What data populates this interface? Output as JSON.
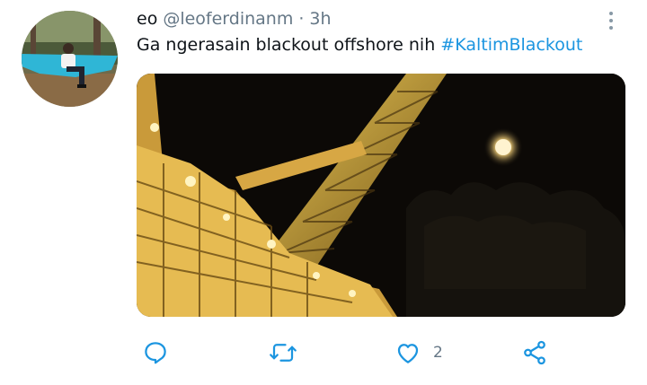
{
  "tweet": {
    "display_name": "eo",
    "handle": "@leoferdinanm",
    "separator": "·",
    "time": "3h",
    "text": "Ga ngerasain blackout  offshore nih",
    "hashtag": "#KaltimBlackout"
  },
  "actions": {
    "reply_count": "",
    "retweet_count": "",
    "like_count": "2",
    "share_count": ""
  },
  "colors": {
    "link": "#1b95e0",
    "secondary_text": "#657786",
    "icon": "#1b95e0"
  },
  "icons": [
    "more-vertical-icon",
    "reply-icon",
    "retweet-icon",
    "like-icon",
    "share-icon"
  ]
}
